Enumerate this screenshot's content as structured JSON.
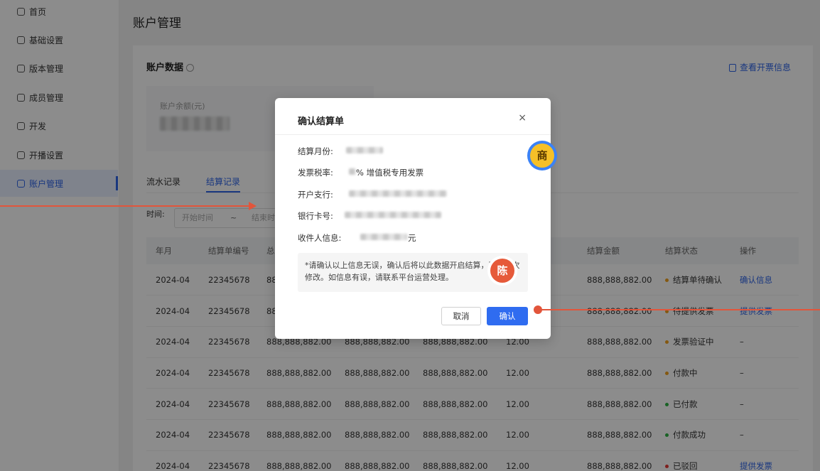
{
  "sidebar": {
    "items": [
      {
        "label": "首页",
        "icon": "home-icon"
      },
      {
        "label": "基础设置",
        "icon": "settings-icon"
      },
      {
        "label": "版本管理",
        "icon": "version-icon"
      },
      {
        "label": "成员管理",
        "icon": "user-icon"
      },
      {
        "label": "开发",
        "icon": "code-icon"
      },
      {
        "label": "开播设置",
        "icon": "broadcast-icon"
      },
      {
        "label": "账户管理",
        "icon": "account-icon",
        "active": true
      }
    ]
  },
  "page": {
    "title": "账户管理"
  },
  "account": {
    "title": "账户数据",
    "invoice_link": "查看开票信息",
    "balance_label": "账户余额(元)"
  },
  "tabs": [
    "流水记录",
    "结算记录"
  ],
  "filter": {
    "label": "时间:",
    "start_placeholder": "开始时间",
    "separator": "~",
    "end_placeholder": "结束时"
  },
  "table": {
    "headers": [
      "年月",
      "结算单编号",
      "总",
      "",
      "",
      "%)",
      "结算金额",
      "结算状态",
      "操作"
    ],
    "rows": [
      {
        "month": "2024-04",
        "no": "22345678",
        "c3": "88",
        "c4": "",
        "c5": "",
        "c6": "",
        "amount": "888,888,882.00",
        "status": "结算单待确认",
        "status_color": "#f0a020",
        "op": "确认信息"
      },
      {
        "month": "2024-04",
        "no": "22345678",
        "c3": "88",
        "c4": "",
        "c5": "",
        "c6": "",
        "amount": "888,888,882.00",
        "status": "待提供发票",
        "status_color": "#f0a020",
        "op": "提供发票"
      },
      {
        "month": "2024-04",
        "no": "22345678",
        "c3": "888,888,882.00",
        "c4": "888,888,882.00",
        "c5": "888,888,882.00",
        "c6": "12.00",
        "amount": "888,888,882.00",
        "status": "发票验证中",
        "status_color": "#f0a020",
        "op": "–"
      },
      {
        "month": "2024-04",
        "no": "22345678",
        "c3": "888,888,882.00",
        "c4": "888,888,882.00",
        "c5": "888,888,882.00",
        "c6": "12.00",
        "amount": "888,888,882.00",
        "status": "付款中",
        "status_color": "#f0a020",
        "op": "–"
      },
      {
        "month": "2024-04",
        "no": "22345678",
        "c3": "888,888,882.00",
        "c4": "888,888,882.00",
        "c5": "888,888,882.00",
        "c6": "12.00",
        "amount": "888,888,882.00",
        "status": "已付款",
        "status_color": "#2fb344",
        "op": "–"
      },
      {
        "month": "2024-04",
        "no": "22345678",
        "c3": "888,888,882.00",
        "c4": "888,888,882.00",
        "c5": "888,888,882.00",
        "c6": "12.00",
        "amount": "888,888,882.00",
        "status": "付款成功",
        "status_color": "#2fb344",
        "op": "–"
      },
      {
        "month": "2024-04",
        "no": "22345678",
        "c3": "888,888,882.00",
        "c4": "888,888,882.00",
        "c5": "888,888,882.00",
        "c6": "12.00",
        "amount": "888,888,882.00",
        "status": "已驳回",
        "status_color": "#e53935",
        "op": "提供发票"
      }
    ]
  },
  "modal": {
    "title": "确认结算单",
    "close": "×",
    "fields": {
      "month_label": "结算月份:",
      "tax_label": "发票税率:",
      "tax_value": "% 增值税专用发票",
      "bank_label": "开户支行:",
      "card_label": "银行卡号:",
      "recipient_label": "收件人信息:",
      "recipient_suffix": "元"
    },
    "note": "*请确认以上信息无误，确认后将以此数据开启结算，不可再次修改。如信息有误，请联系平台运营处理。",
    "cancel": "取消",
    "confirm": "确认"
  },
  "badges": {
    "shang": "商",
    "chen": "陈"
  },
  "colors": {
    "accent": "#2f64e8",
    "annotation": "#e2553b"
  }
}
